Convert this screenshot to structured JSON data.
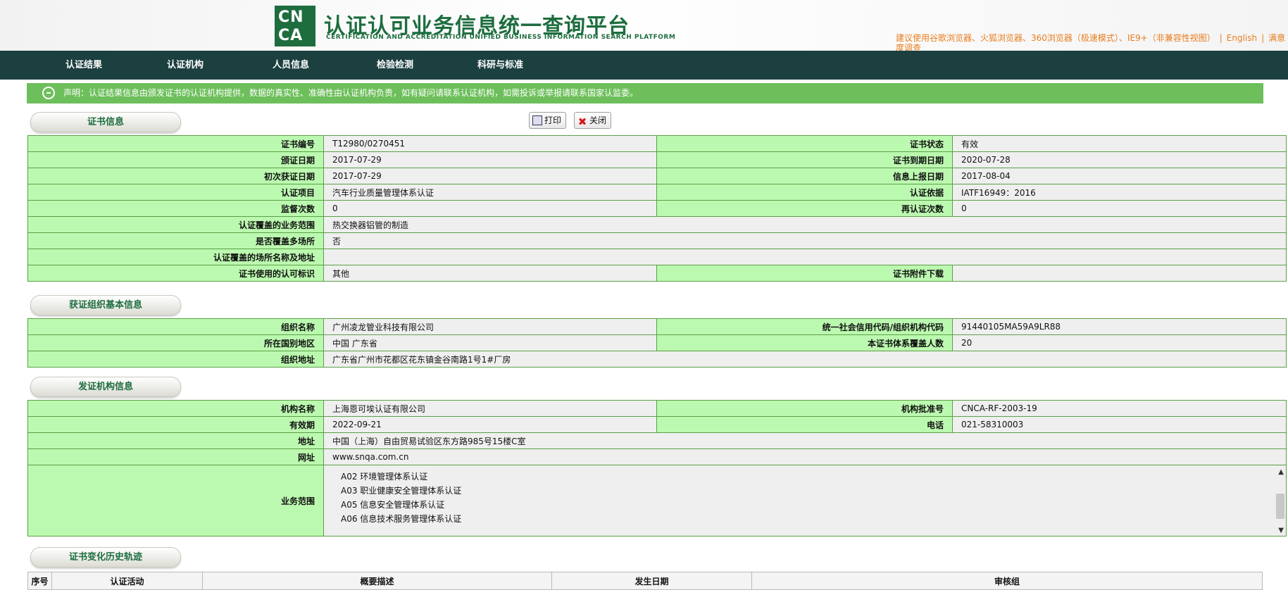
{
  "header": {
    "logo_line1": "CN",
    "logo_line2": "CA",
    "title": "认证认可业务信息统一查询平台",
    "subtitle": "CERTIFICATION AND ACCREDITATION UNIFIED BUSINESS INFORMATION SEARCH PLATFORM",
    "browser_tip": "建议使用谷歌浏览器、火狐浏览器、360浏览器（极速模式）、IE9+（非兼容性视图）",
    "english_link": "English",
    "extra_link": "满意度调查"
  },
  "nav": {
    "items": [
      "认证结果",
      "认证机构",
      "人员信息",
      "检验检测",
      "科研与标准"
    ]
  },
  "notice": {
    "text": "声明：认证结果信息由颁发证书的认证机构提供，数据的真实性、准确性由认证机构负责，如有疑问请联系认证机构，如需投诉或举报请联系国家认监委。"
  },
  "toolbar": {
    "print_label": "打印",
    "close_label": "关闭"
  },
  "sections": {
    "cert_info": "证书信息",
    "org_info": "获证组织基本信息",
    "issuer_info": "发证机构信息",
    "history": "证书变化历史轨迹"
  },
  "cert": {
    "cert_no_label": "证书编号",
    "cert_no": "T12980/0270451",
    "status_label": "证书状态",
    "status": "有效",
    "issue_date_label": "颁证日期",
    "issue_date": "2017-07-29",
    "expire_date_label": "证书到期日期",
    "expire_date": "2020-07-28",
    "first_date_label": "初次获证日期",
    "first_date": "2017-07-29",
    "report_date_label": "信息上报日期",
    "report_date": "2017-08-04",
    "project_label": "认证项目",
    "project": "汽车行业质量管理体系认证",
    "basis_label": "认证依据",
    "basis": "IATF16949：2016",
    "supervise_label": "监督次数",
    "supervise": "0",
    "recert_label": "再认证次数",
    "recert": "0",
    "scope_label": "认证覆盖的业务范围",
    "scope": "热交换器铝管的制造",
    "multisite_label": "是否覆盖多场所",
    "multisite": "否",
    "sites_label": "认证覆盖的场所名称及地址",
    "sites": "",
    "mark_label": "证书使用的认可标识",
    "mark": "其他",
    "attach_label": "证书附件下载",
    "attach": ""
  },
  "org": {
    "name_label": "组织名称",
    "name": "广州凌龙管业科技有限公司",
    "code_label": "统一社会信用代码/组织机构代码",
    "code": "91440105MA59A9LR88",
    "region_label": "所在国别地区",
    "region": "中国 广东省",
    "headcount_label": "本证书体系覆盖人数",
    "headcount": "20",
    "address_label": "组织地址",
    "address": "广东省广州市花都区花东镇金谷南路1号1#厂房"
  },
  "issuer": {
    "name_label": "机构名称",
    "name": "上海恩可埃认证有限公司",
    "approval_label": "机构批准号",
    "approval": "CNCA-RF-2003-19",
    "valid_label": "有效期",
    "valid": "2022-09-21",
    "phone_label": "电话",
    "phone": "021-58310003",
    "address_label": "地址",
    "address": "中国（上海）自由贸易试验区东方路985号15楼C室",
    "website_label": "网址",
    "website": "www.snqa.com.cn",
    "scope_label": "业务范围",
    "scope_items": [
      "A02 环境管理体系认证",
      "A03 职业健康安全管理体系认证",
      "A05 信息安全管理体系认证",
      "A06 信息技术服务管理体系认证"
    ]
  },
  "history_table": {
    "headers": [
      "序号",
      "认证活动",
      "概要描述",
      "发生日期",
      "审核组"
    ]
  }
}
